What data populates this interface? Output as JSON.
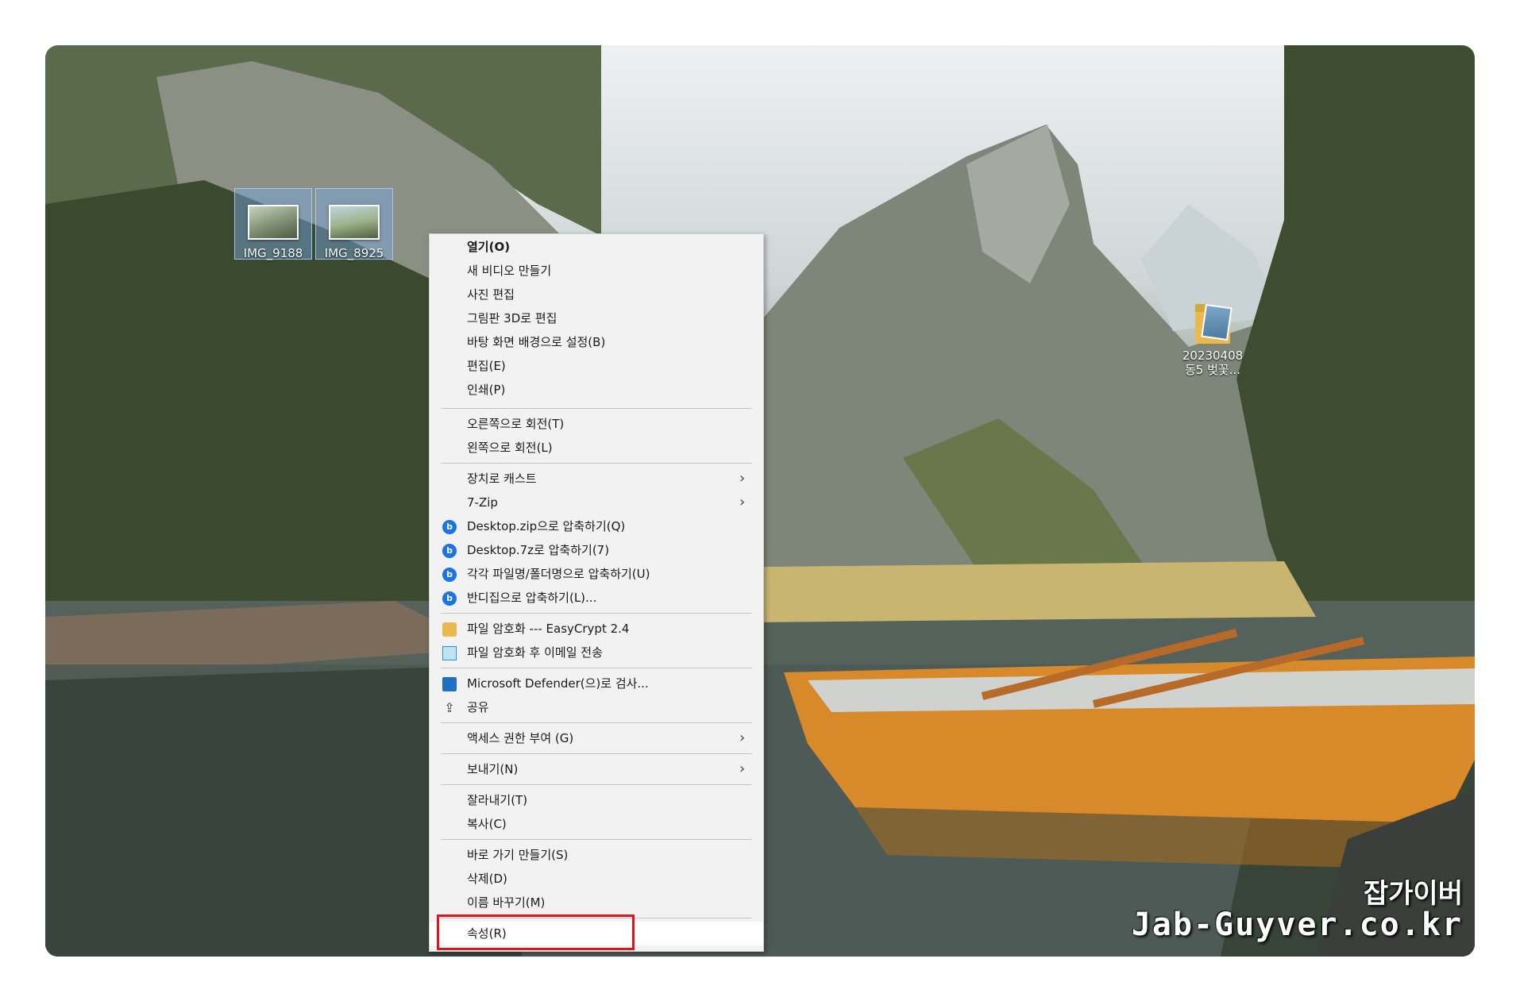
{
  "desktop": {
    "icons": [
      {
        "label": "IMG_9188"
      },
      {
        "label": "IMG_8925"
      },
      {
        "label_line1": "20230408",
        "label_line2": "동5 벚꽃..."
      }
    ]
  },
  "context_menu": {
    "items": [
      {
        "label": "열기(O)"
      },
      {
        "label": "새 비디오 만들기"
      },
      {
        "label": "사진 편집"
      },
      {
        "label": "그림판 3D로 편집"
      },
      {
        "label": "바탕 화면 배경으로 설정(B)"
      },
      {
        "label": "편집(E)"
      },
      {
        "label": "인쇄(P)"
      },
      {
        "label": "오른쪽으로 회전(T)"
      },
      {
        "label": "왼쪽으로 회전(L)"
      },
      {
        "label": "장치로 캐스트"
      },
      {
        "label": "7-Zip"
      },
      {
        "label": "Desktop.zip으로 압축하기(Q)"
      },
      {
        "label": "Desktop.7z로 압축하기(7)"
      },
      {
        "label": "각각 파일명/폴더명으로 압축하기(U)"
      },
      {
        "label": "반디집으로 압축하기(L)..."
      },
      {
        "label": "파일 암호화 --- EasyCrypt 2.4"
      },
      {
        "label": "파일 암호화 후 이메일 전송"
      },
      {
        "label": "Microsoft Defender(으)로 검사..."
      },
      {
        "label": "공유"
      },
      {
        "label": "액세스 권한 부여 (G)"
      },
      {
        "label": "보내기(N)"
      },
      {
        "label": "잘라내기(T)"
      },
      {
        "label": "복사(C)"
      },
      {
        "label": "바로 가기 만들기(S)"
      },
      {
        "label": "삭제(D)"
      },
      {
        "label": "이름 바꾸기(M)"
      },
      {
        "label": "속성(R)"
      }
    ],
    "submenu_arrow": "›",
    "highlight_color": "#e0141e"
  },
  "watermark": {
    "line1": "잡가이버",
    "line2": "Jab-Guyver.co.kr"
  }
}
